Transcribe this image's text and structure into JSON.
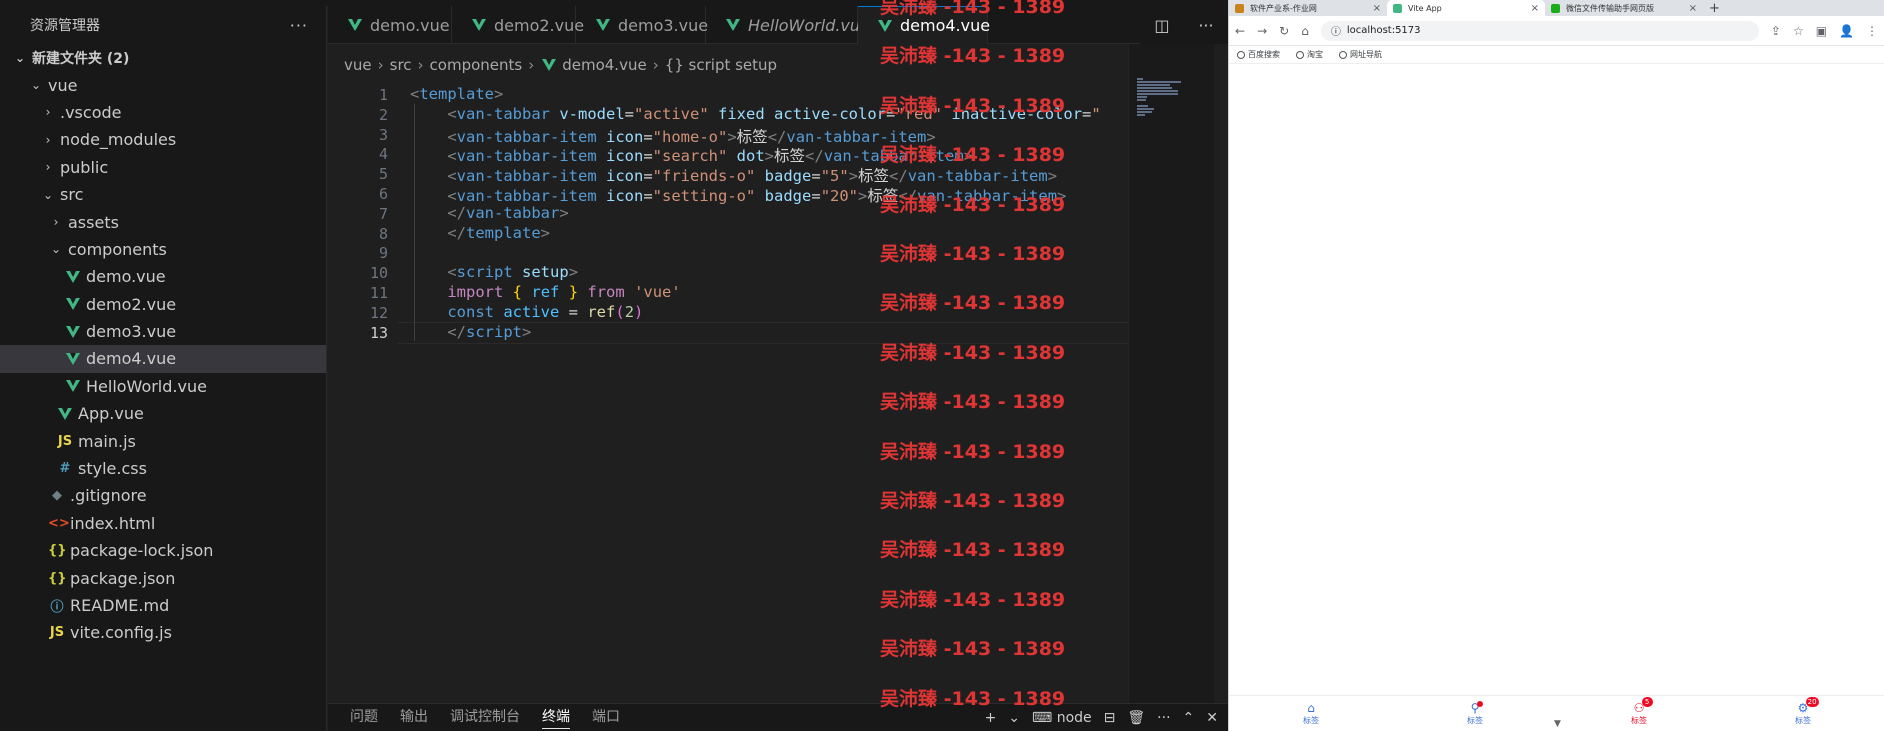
{
  "sidebar": {
    "title": "资源管理器",
    "more": "···",
    "tree": [
      {
        "label": "新建文件夹 (2)",
        "twisty": "⌄",
        "icon": "",
        "kind": "section",
        "depth": 0
      },
      {
        "label": "vue",
        "twisty": "⌄",
        "icon": "",
        "kind": "folder",
        "depth": 1
      },
      {
        "label": ".vscode",
        "twisty": "›",
        "icon": "",
        "kind": "folder",
        "depth": 2
      },
      {
        "label": "node_modules",
        "twisty": "›",
        "icon": "",
        "kind": "folder",
        "depth": 2
      },
      {
        "label": "public",
        "twisty": "›",
        "icon": "",
        "kind": "folder",
        "depth": 2
      },
      {
        "label": "src",
        "twisty": "⌄",
        "icon": "",
        "kind": "folder",
        "depth": 2
      },
      {
        "label": "assets",
        "twisty": "›",
        "icon": "",
        "kind": "folder",
        "depth": 3
      },
      {
        "label": "components",
        "twisty": "⌄",
        "icon": "",
        "kind": "folder",
        "depth": 3
      },
      {
        "label": "demo.vue",
        "twisty": "",
        "icon": "vue",
        "kind": "file",
        "depth": 4
      },
      {
        "label": "demo2.vue",
        "twisty": "",
        "icon": "vue",
        "kind": "file",
        "depth": 4
      },
      {
        "label": "demo3.vue",
        "twisty": "",
        "icon": "vue",
        "kind": "file",
        "depth": 4
      },
      {
        "label": "demo4.vue",
        "twisty": "",
        "icon": "vue",
        "kind": "file",
        "depth": 4,
        "selected": true
      },
      {
        "label": "HelloWorld.vue",
        "twisty": "",
        "icon": "vue",
        "kind": "file",
        "depth": 4
      },
      {
        "label": "App.vue",
        "twisty": "",
        "icon": "vue",
        "kind": "file",
        "depth": 3
      },
      {
        "label": "main.js",
        "twisty": "",
        "icon": "JS",
        "kind": "file",
        "depth": 3
      },
      {
        "label": "style.css",
        "twisty": "",
        "icon": "#",
        "kind": "file",
        "depth": 3
      },
      {
        "label": ".gitignore",
        "twisty": "",
        "icon": "◆",
        "kind": "file",
        "depth": 2
      },
      {
        "label": "index.html",
        "twisty": "",
        "icon": "<>",
        "kind": "file",
        "depth": 2
      },
      {
        "label": "package-lock.json",
        "twisty": "",
        "icon": "{}",
        "kind": "file",
        "depth": 2
      },
      {
        "label": "package.json",
        "twisty": "",
        "icon": "{}",
        "kind": "file",
        "depth": 2
      },
      {
        "label": "README.md",
        "twisty": "",
        "icon": "ⓘ",
        "kind": "file",
        "depth": 2
      },
      {
        "label": "vite.config.js",
        "twisty": "",
        "icon": "JS",
        "kind": "file",
        "depth": 2
      }
    ]
  },
  "tabs": [
    {
      "label": "demo.vue",
      "dirty": true,
      "active": false,
      "italic": false
    },
    {
      "label": "demo2.vue",
      "dirty": true,
      "active": false,
      "italic": false
    },
    {
      "label": "demo3.vue",
      "dirty": true,
      "active": false,
      "italic": false
    },
    {
      "label": "HelloWorld.vue",
      "dirty": false,
      "active": false,
      "italic": true
    },
    {
      "label": "demo4.vue",
      "dirty": true,
      "active": true,
      "italic": false
    }
  ],
  "breadcrumb": [
    "vue",
    "src",
    "components",
    "demo4.vue",
    "{} script setup"
  ],
  "code": {
    "current_line": 13,
    "lines": [
      [
        [
          "t-br",
          "<"
        ],
        [
          "t-tag",
          "template"
        ],
        [
          "t-br",
          ">"
        ]
      ],
      [
        [
          "t-txt",
          "    "
        ],
        [
          "t-br",
          "<"
        ],
        [
          "t-tag",
          "van-tabbar"
        ],
        [
          "t-txt",
          " "
        ],
        [
          "t-attr",
          "v-model"
        ],
        [
          "t-txt",
          "="
        ],
        [
          "t-str",
          "\"active\""
        ],
        [
          "t-txt",
          " "
        ],
        [
          "t-attr",
          "fixed"
        ],
        [
          "t-txt",
          " "
        ],
        [
          "t-attr",
          "active-color"
        ],
        [
          "t-txt",
          "="
        ],
        [
          "t-str",
          "\"red\""
        ],
        [
          "t-txt",
          " "
        ],
        [
          "t-attr",
          "inactive-color"
        ],
        [
          "t-txt",
          "="
        ],
        [
          "t-str",
          "\""
        ]
      ],
      [
        [
          "t-txt",
          "    "
        ],
        [
          "t-br",
          "<"
        ],
        [
          "t-tag",
          "van-tabbar-item"
        ],
        [
          "t-txt",
          " "
        ],
        [
          "t-attr",
          "icon"
        ],
        [
          "t-txt",
          "="
        ],
        [
          "t-str",
          "\"home-o\""
        ],
        [
          "t-br",
          ">"
        ],
        [
          "t-txt",
          "标签"
        ],
        [
          "t-br",
          "</"
        ],
        [
          "t-tag",
          "van-tabbar-item"
        ],
        [
          "t-br",
          ">"
        ]
      ],
      [
        [
          "t-txt",
          "    "
        ],
        [
          "t-br",
          "<"
        ],
        [
          "t-tag",
          "van-tabbar-item"
        ],
        [
          "t-txt",
          " "
        ],
        [
          "t-attr",
          "icon"
        ],
        [
          "t-txt",
          "="
        ],
        [
          "t-str",
          "\"search\""
        ],
        [
          "t-txt",
          " "
        ],
        [
          "t-attr",
          "dot"
        ],
        [
          "t-br",
          ">"
        ],
        [
          "t-txt",
          "标签"
        ],
        [
          "t-br",
          "</"
        ],
        [
          "t-tag",
          "van-tabbar-item"
        ],
        [
          "t-br",
          ">"
        ]
      ],
      [
        [
          "t-txt",
          "    "
        ],
        [
          "t-br",
          "<"
        ],
        [
          "t-tag",
          "van-tabbar-item"
        ],
        [
          "t-txt",
          " "
        ],
        [
          "t-attr",
          "icon"
        ],
        [
          "t-txt",
          "="
        ],
        [
          "t-str",
          "\"friends-o\""
        ],
        [
          "t-txt",
          " "
        ],
        [
          "t-attr",
          "badge"
        ],
        [
          "t-txt",
          "="
        ],
        [
          "t-str",
          "\"5\""
        ],
        [
          "t-br",
          ">"
        ],
        [
          "t-txt",
          "标签"
        ],
        [
          "t-br",
          "</"
        ],
        [
          "t-tag",
          "van-tabbar-item"
        ],
        [
          "t-br",
          ">"
        ]
      ],
      [
        [
          "t-txt",
          "    "
        ],
        [
          "t-br",
          "<"
        ],
        [
          "t-tag",
          "van-tabbar-item"
        ],
        [
          "t-txt",
          " "
        ],
        [
          "t-attr",
          "icon"
        ],
        [
          "t-txt",
          "="
        ],
        [
          "t-str",
          "\"setting-o\""
        ],
        [
          "t-txt",
          " "
        ],
        [
          "t-attr",
          "badge"
        ],
        [
          "t-txt",
          "="
        ],
        [
          "t-str",
          "\"20\""
        ],
        [
          "t-br",
          ">"
        ],
        [
          "t-txt",
          "标签"
        ],
        [
          "t-br",
          "</"
        ],
        [
          "t-tag",
          "van-tabbar-item"
        ],
        [
          "t-br",
          ">"
        ]
      ],
      [
        [
          "t-txt",
          "    "
        ],
        [
          "t-br",
          "</"
        ],
        [
          "t-tag",
          "van-tabbar"
        ],
        [
          "t-br",
          ">"
        ]
      ],
      [
        [
          "t-txt",
          "    "
        ],
        [
          "t-br",
          "</"
        ],
        [
          "t-tag",
          "template"
        ],
        [
          "t-br",
          ">"
        ]
      ],
      [],
      [
        [
          "t-txt",
          "    "
        ],
        [
          "t-br",
          "<"
        ],
        [
          "t-tag",
          "script"
        ],
        [
          "t-txt",
          " "
        ],
        [
          "t-attr",
          "setup"
        ],
        [
          "t-br",
          ">"
        ]
      ],
      [
        [
          "t-txt",
          "    "
        ],
        [
          "t-kw",
          "import"
        ],
        [
          "t-txt",
          " "
        ],
        [
          "t-brace",
          "{"
        ],
        [
          "t-txt",
          " "
        ],
        [
          "t-var",
          "ref"
        ],
        [
          "t-txt",
          " "
        ],
        [
          "t-brace",
          "}"
        ],
        [
          "t-txt",
          " "
        ],
        [
          "t-kw",
          "from"
        ],
        [
          "t-txt",
          " "
        ],
        [
          "t-str",
          "'vue'"
        ]
      ],
      [
        [
          "t-txt",
          "    "
        ],
        [
          "t-decl",
          "const"
        ],
        [
          "t-txt",
          " "
        ],
        [
          "t-var",
          "active"
        ],
        [
          "t-txt",
          " = "
        ],
        [
          "t-fn",
          "ref"
        ],
        [
          "t-paren",
          "("
        ],
        [
          "t-num",
          "2"
        ],
        [
          "t-paren",
          ")"
        ]
      ],
      [
        [
          "t-txt",
          "    "
        ],
        [
          "t-br",
          "</"
        ],
        [
          "t-tag",
          "script"
        ],
        [
          "t-br",
          ">"
        ]
      ]
    ]
  },
  "watermark": {
    "text": "吴沛臻 -143 - 1389",
    "count": 15,
    "color": "#e03535"
  },
  "panel": {
    "tabs": [
      "问题",
      "输出",
      "调试控制台",
      "终端",
      "端口"
    ],
    "active": "终端",
    "terminal_label": "node",
    "actions": [
      "+",
      "⌄",
      "⊟",
      "🗑",
      "···",
      "⌃",
      "✕"
    ]
  },
  "browser": {
    "tabs": [
      {
        "label": "软件产业系-作业网",
        "favicon_color": "#c8841a",
        "active": false
      },
      {
        "label": "Vite App",
        "favicon_color": "#41b883",
        "active": true
      },
      {
        "label": "微信文件传输助手网页版",
        "favicon_color": "#1aad19",
        "active": false
      }
    ],
    "new_tab": "+",
    "nav": {
      "back": "←",
      "forward": "→",
      "reload": "↻",
      "home": "⌂"
    },
    "address": "localhost:5173",
    "right_icons": [
      "⇪",
      "☆",
      "▣",
      "👤",
      "⋮"
    ],
    "bookmarks": [
      "百度搜索",
      "淘宝",
      "网址导航"
    ]
  },
  "van_tabbar": {
    "active_index": 2,
    "active_color": "#ee0a24",
    "items": [
      {
        "label": "标签",
        "icon": "⌂",
        "dot": false,
        "badge": ""
      },
      {
        "label": "标签",
        "icon": "⚲",
        "dot": true,
        "badge": ""
      },
      {
        "label": "标签",
        "icon": "⚇",
        "dot": false,
        "badge": "5"
      },
      {
        "label": "标签",
        "icon": "⚙",
        "dot": false,
        "badge": "20"
      }
    ]
  }
}
